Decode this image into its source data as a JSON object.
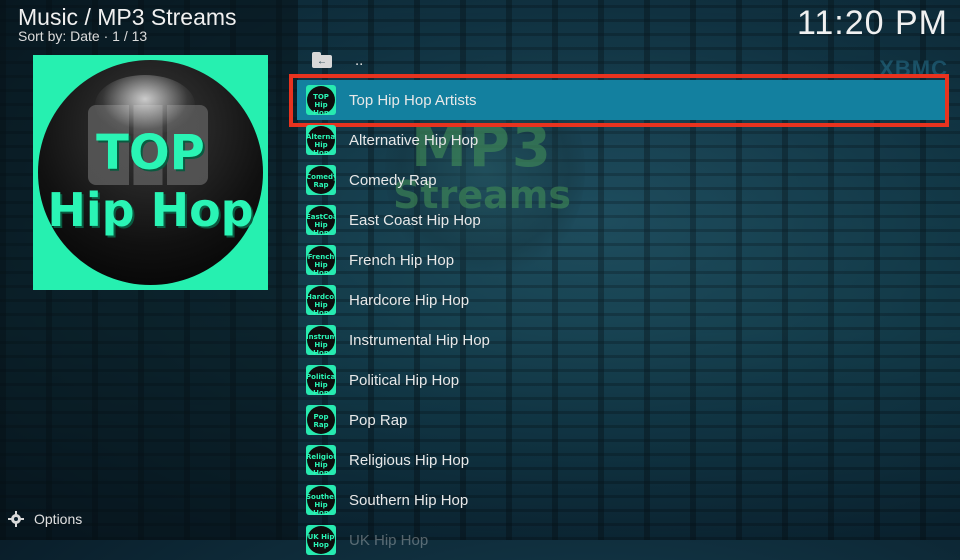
{
  "header": {
    "title": "Music / MP3 Streams",
    "sort_info": "Sort by: Date  ·  1 / 13",
    "clock": "11:20 PM"
  },
  "background": {
    "logo_line1": "MP3",
    "logo_line2": "Streams",
    "corner_text": "XBMC"
  },
  "artwork": {
    "line1": "TOP",
    "line2": "Hip Hop"
  },
  "list": {
    "parent_label": "..",
    "items": [
      {
        "label": "Top Hip Hop Artists",
        "thumb": "TOP Hip Hop"
      },
      {
        "label": "Alternative Hip Hop",
        "thumb": "Alternative Hip Hop"
      },
      {
        "label": "Comedy Rap",
        "thumb": "Comedy Rap"
      },
      {
        "label": "East Coast Hip Hop",
        "thumb": "EastCoast Hip Hop"
      },
      {
        "label": "French Hip Hop",
        "thumb": "French Hip Hop"
      },
      {
        "label": "Hardcore Hip Hop",
        "thumb": "Hardcore Hip Hop"
      },
      {
        "label": "Instrumental Hip Hop",
        "thumb": "Instrumental Hip Hop"
      },
      {
        "label": "Political Hip Hop",
        "thumb": "Political Hip Hop"
      },
      {
        "label": "Pop Rap",
        "thumb": "Pop Rap"
      },
      {
        "label": "Religious Hip Hop",
        "thumb": "Religious Hip Hop"
      },
      {
        "label": "Southern Hip Hop",
        "thumb": "Southern Hip Hop"
      },
      {
        "label": "UK Hip Hop",
        "thumb": "UK Hip Hop"
      }
    ]
  },
  "footer": {
    "options_label": "Options"
  },
  "colors": {
    "selection_fill": "#13809f",
    "selection_border": "#e8331f",
    "thumb_accent": "#27eab0"
  },
  "icons": {
    "parent": "folder-back-icon",
    "options": "gear-icon"
  }
}
